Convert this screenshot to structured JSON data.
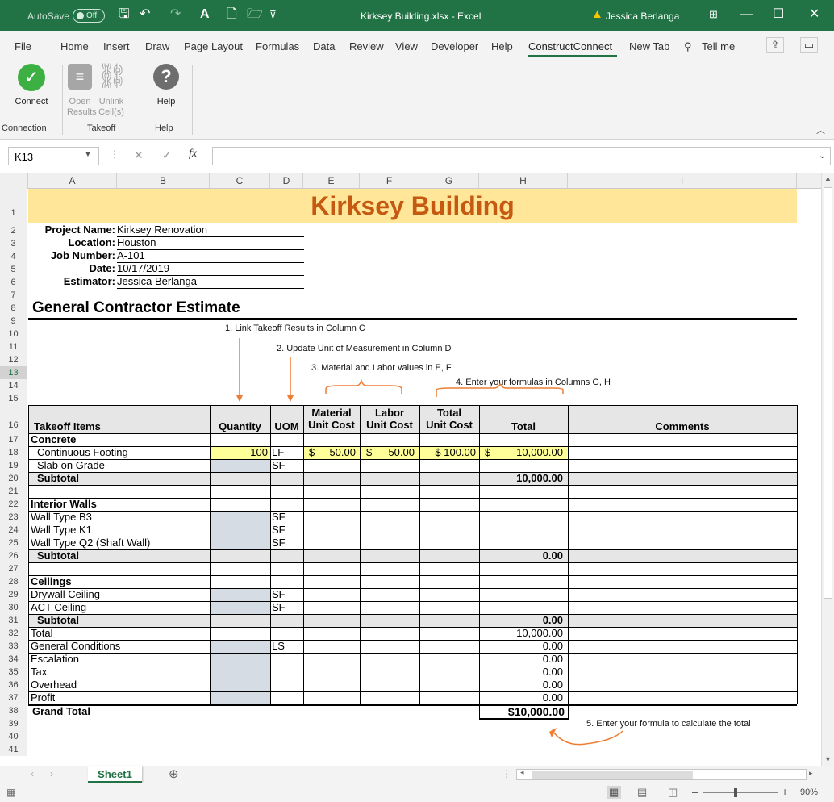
{
  "titlebar": {
    "autosave": "AutoSave",
    "autosave_state": "Off",
    "filename": "Kirksey Building.xlsx - Excel",
    "user": "Jessica Berlanga"
  },
  "menu": [
    "File",
    "Home",
    "Insert",
    "Draw",
    "Page Layout",
    "Formulas",
    "Data",
    "Review",
    "View",
    "Developer",
    "Help",
    "ConstructConnect",
    "New Tab",
    "Tell me"
  ],
  "ribbon": {
    "connect": "Connect",
    "open_results": "Open Results",
    "unlink_cells": "Unlink Cell(s)",
    "help": "Help",
    "groups": [
      "Connection",
      "Takeoff",
      "Help"
    ]
  },
  "formula_bar": {
    "name_box": "K13",
    "formula": ""
  },
  "columns": [
    "A",
    "B",
    "C",
    "D",
    "E",
    "F",
    "G",
    "H",
    "I"
  ],
  "rows": [
    "1",
    "2",
    "3",
    "4",
    "5",
    "6",
    "7",
    "8",
    "9",
    "10",
    "11",
    "12",
    "13",
    "14",
    "15",
    "16",
    "17",
    "18",
    "19",
    "20",
    "21",
    "22",
    "23",
    "24",
    "25",
    "26",
    "27",
    "28",
    "29",
    "30",
    "31",
    "32",
    "33",
    "34",
    "35",
    "36",
    "37",
    "38",
    "39",
    "40",
    "41"
  ],
  "sheet": {
    "title": "Kirksey Building",
    "project_label": "Project Name:",
    "project_value": "Kirksey Renovation",
    "location_label": "Location:",
    "location_value": "Houston",
    "job_label": "Job Number:",
    "job_value": "A-101",
    "date_label": "Date:",
    "date_value": "10/17/2019",
    "estimator_label": "Estimator:",
    "estimator_value": "Jessica Berlanga",
    "heading": "General Contractor Estimate",
    "annotations": [
      "1. Link Takeoff Results in Column C",
      "2. Update Unit of Measurement in Column D",
      "3.  Material and Labor values in E, F",
      "4. Enter your formulas in Columns G, H",
      "5. Enter your formula to calculate the total"
    ],
    "headers": {
      "items": "Takeoff Items",
      "qty": "Quantity",
      "uom": "UOM",
      "mat1": "Material",
      "mat2": "Unit Cost",
      "lab1": "Labor",
      "lab2": "Unit Cost",
      "tot1": "Total",
      "tot2": "Unit Cost",
      "total": "Total",
      "comments": "Comments"
    },
    "concrete": "Concrete",
    "cf": "Continuous Footing",
    "cf_qty": "100",
    "cf_uom": "LF",
    "cf_mat_sym": "$",
    "cf_mat": "50.00",
    "cf_lab_sym": "$",
    "cf_lab": "50.00",
    "cf_tuc": "$ 100.00",
    "cf_tot_sym": "$",
    "cf_tot": "10,000.00",
    "slab": "Slab on Grade",
    "slab_uom": "SF",
    "subtotal": "Subtotal",
    "sub1": "10,000.00",
    "interior": "Interior Walls",
    "wb3": "Wall Type B3",
    "wk1": "Wall Type K1",
    "wq2": "Wall Type Q2 (Shaft Wall)",
    "sf": "SF",
    "sub2": "0.00",
    "ceilings": "Ceilings",
    "drywall": "Drywall Ceiling",
    "act": "ACT Ceiling",
    "sub3": "0.00",
    "total_label": "Total",
    "total_val": "10,000.00",
    "gc": "General Conditions",
    "gc_uom": "LS",
    "gc_val": "0.00",
    "esc": "Escalation",
    "esc_val": "0.00",
    "tax": "Tax",
    "tax_val": "0.00",
    "ovh": "Overhead",
    "ovh_val": "0.00",
    "profit": "Profit",
    "profit_val": "0.00",
    "grand": "Grand Total",
    "grand_val": "$10,000.00"
  },
  "sheet_tab": "Sheet1",
  "zoom": "90%"
}
